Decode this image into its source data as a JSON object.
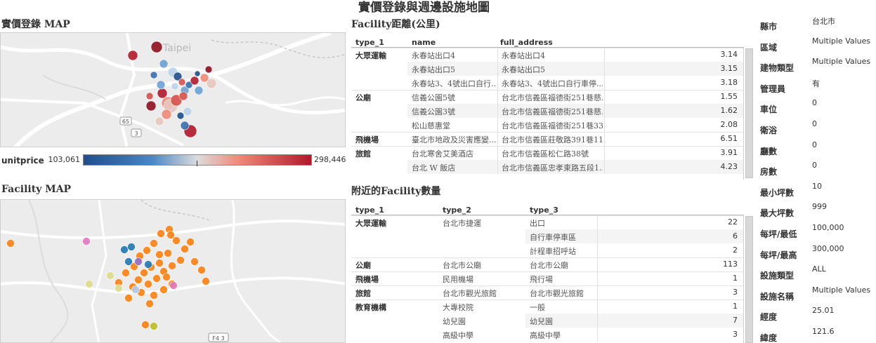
{
  "page_title": "實價登錄與週邊設施地圖",
  "price_map": {
    "title": "實價登錄 MAP",
    "city_label": "Taipei",
    "road_shields": [
      "65",
      "3"
    ],
    "legend_field": "unitprice",
    "legend_min": "103,061",
    "legend_max": "298,446",
    "colors": {
      "low": "#1f4e8c",
      "mid": "#e8e4e0",
      "high": "#b2182b"
    }
  },
  "facility_map": {
    "title": "Facility MAP",
    "road_shield": "F4 3"
  },
  "distance_table": {
    "title": "Facility距離(公里)",
    "columns": [
      "type_1",
      "name",
      "full_address"
    ],
    "groups": [
      {
        "type_1": "大眾運輸",
        "rows": [
          {
            "name": "永春站出口4",
            "address": "永春站出口4",
            "value": "3.14"
          },
          {
            "name": "永春站出口5",
            "address": "永春站出口5",
            "value": "3.15"
          },
          {
            "name": "永春站3、4號出口自行...",
            "address": "永春站3、4號出口自行車停...",
            "value": "3.18"
          }
        ]
      },
      {
        "type_1": "公廟",
        "rows": [
          {
            "name": "信義公園5號",
            "address": "台北市信義區福德街251巷慈...",
            "value": "1.55"
          },
          {
            "name": "信義公園3號",
            "address": "台北市信義區福德街251巷慈...",
            "value": "1.62"
          },
          {
            "name": "松山慈惠堂",
            "address": "台北市信義區福德街251巷33...",
            "value": "2.08"
          }
        ]
      },
      {
        "type_1": "飛機場",
        "rows": [
          {
            "name": "臺北市地政及災害應變...",
            "address": "台北市信義區莊敬路391巷11...",
            "value": "6.51"
          }
        ]
      },
      {
        "type_1": "旅館",
        "rows": [
          {
            "name": "台北寒舍艾美酒店",
            "address": "台北市信義區松仁路38號",
            "value": "3.91"
          },
          {
            "name": "台北 W 飯店",
            "address": "台北市信義區忠孝東路五段1...",
            "value": "4.23"
          }
        ]
      }
    ]
  },
  "count_table": {
    "title": "附近的Facility數量",
    "columns": [
      "type_1",
      "type_2",
      "type_3"
    ],
    "groups": [
      {
        "type_1": "大眾運輸",
        "rows": [
          {
            "type_2": "台北市捷運",
            "type_3": "出口",
            "value": "22"
          },
          {
            "type_2": "",
            "type_3": "自行車停車區",
            "value": "6"
          },
          {
            "type_2": "",
            "type_3": "計程車招呼站",
            "value": "2"
          }
        ]
      },
      {
        "type_1": "公廟",
        "rows": [
          {
            "type_2": "台北市公廟",
            "type_3": "台北市公廟",
            "value": "113"
          }
        ]
      },
      {
        "type_1": "飛機場",
        "rows": [
          {
            "type_2": "民用機場",
            "type_3": "飛行場",
            "value": "1"
          }
        ]
      },
      {
        "type_1": "旅館",
        "rows": [
          {
            "type_2": "台北市觀光旅館",
            "type_3": "台北市觀光旅館",
            "value": "3"
          }
        ]
      },
      {
        "type_1": "教育機構",
        "rows": [
          {
            "type_2": "大專校院",
            "type_3": "一般",
            "value": "1"
          },
          {
            "type_2": "幼兒園",
            "type_3": "幼兒園",
            "value": "7"
          },
          {
            "type_2": "高級中學",
            "type_3": "高級中學",
            "value": "3"
          }
        ]
      }
    ]
  },
  "filters": [
    {
      "label": "縣市",
      "value": "台北市"
    },
    {
      "label": "區域",
      "value": "Multiple Values"
    },
    {
      "label": "建物類型",
      "value": "Multiple Values"
    },
    {
      "label": "管理員",
      "value": "有"
    },
    {
      "label": "車位",
      "value": "0"
    },
    {
      "label": "衛浴",
      "value": "0"
    },
    {
      "label": "廳數",
      "value": "0"
    },
    {
      "label": "房數",
      "value": "0"
    },
    {
      "label": "最小坪數",
      "value": "10"
    },
    {
      "label": "最大坪數",
      "value": "999"
    },
    {
      "label": "每坪/最低",
      "value": "100,000"
    },
    {
      "label": "每坪/最高",
      "value": "300,000"
    },
    {
      "label": "設施類型",
      "value": "ALL"
    },
    {
      "label": "設施名稱",
      "value": "Multiple Values"
    },
    {
      "label": "經度",
      "value": "25.01"
    },
    {
      "label": "緯度",
      "value": "121.6"
    }
  ]
}
